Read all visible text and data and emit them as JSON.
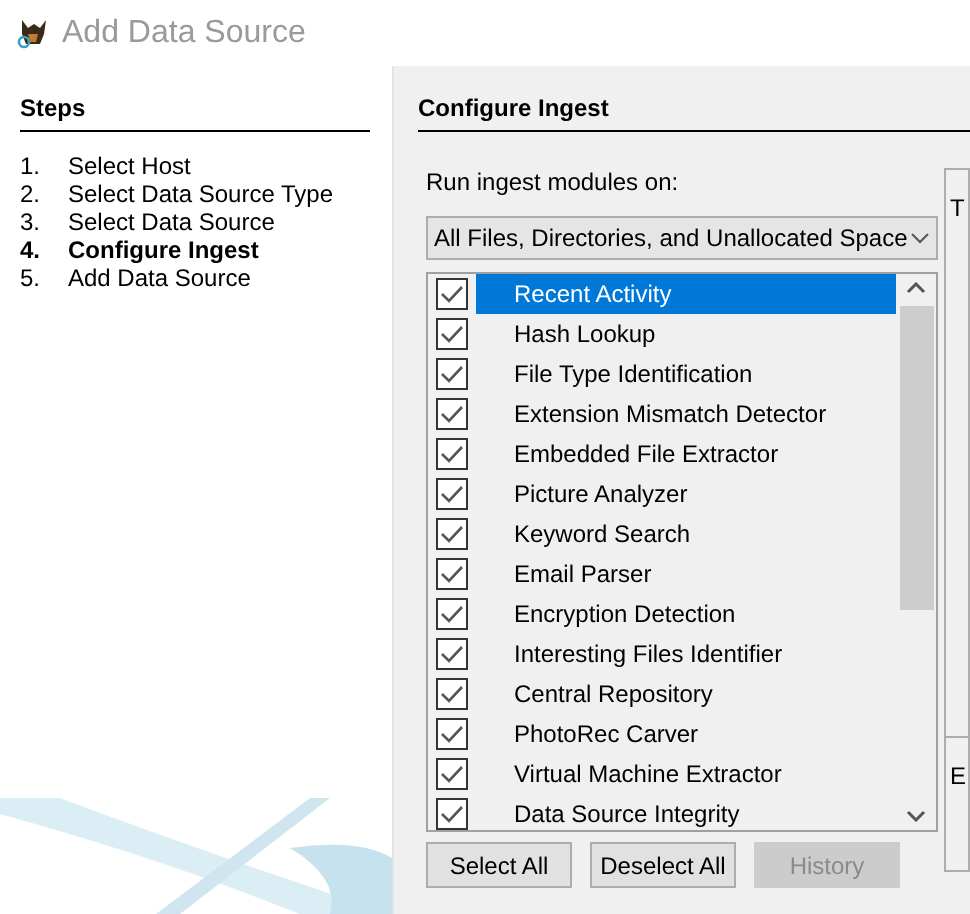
{
  "window": {
    "title": "Add Data Source"
  },
  "steps": {
    "heading": "Steps",
    "items": [
      {
        "number": "1.",
        "label": "Select Host",
        "selected": false
      },
      {
        "number": "2.",
        "label": "Select Data Source Type",
        "selected": false
      },
      {
        "number": "3.",
        "label": "Select Data Source",
        "selected": false
      },
      {
        "number": "4.",
        "label": "Configure Ingest",
        "selected": true
      },
      {
        "number": "5.",
        "label": "Add Data Source",
        "selected": false
      }
    ]
  },
  "panel": {
    "heading": "Configure Ingest",
    "run_label": "Run ingest modules on:",
    "dropdown": {
      "value": "All Files, Directories, and Unallocated Space"
    },
    "modules": [
      {
        "label": "Recent Activity",
        "checked": true,
        "selected": true
      },
      {
        "label": "Hash Lookup",
        "checked": true,
        "selected": false
      },
      {
        "label": "File Type Identification",
        "checked": true,
        "selected": false
      },
      {
        "label": "Extension Mismatch Detector",
        "checked": true,
        "selected": false
      },
      {
        "label": "Embedded File Extractor",
        "checked": true,
        "selected": false
      },
      {
        "label": "Picture Analyzer",
        "checked": true,
        "selected": false
      },
      {
        "label": "Keyword Search",
        "checked": true,
        "selected": false
      },
      {
        "label": "Email Parser",
        "checked": true,
        "selected": false
      },
      {
        "label": "Encryption Detection",
        "checked": true,
        "selected": false
      },
      {
        "label": "Interesting Files Identifier",
        "checked": true,
        "selected": false
      },
      {
        "label": "Central Repository",
        "checked": true,
        "selected": false
      },
      {
        "label": "PhotoRec Carver",
        "checked": true,
        "selected": false
      },
      {
        "label": "Virtual Machine Extractor",
        "checked": true,
        "selected": false
      },
      {
        "label": "Data Source Integrity",
        "checked": true,
        "selected": false
      }
    ],
    "buttons": [
      {
        "label": "Select All",
        "disabled": false
      },
      {
        "label": "Deselect All",
        "disabled": false
      },
      {
        "label": "History",
        "disabled": true
      }
    ],
    "side_panel": {
      "top_label": "T",
      "bottom_label": "E"
    }
  }
}
